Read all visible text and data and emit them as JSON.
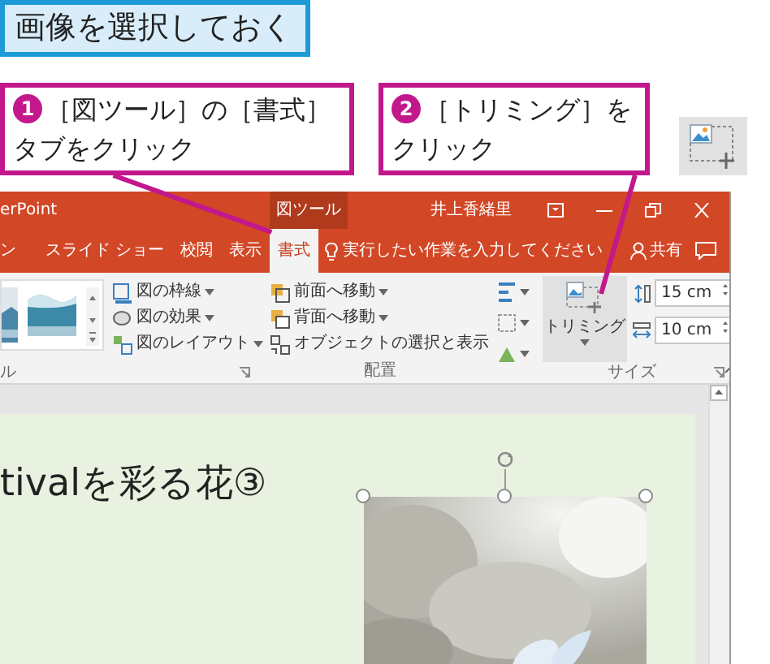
{
  "heading": "画像を選択しておく",
  "callouts": [
    {
      "number": "1",
      "lines": [
        "［図ツール］の［書式］",
        "タブをクリック"
      ]
    },
    {
      "number": "2",
      "lines": [
        "［トリミング］を",
        "クリック"
      ]
    }
  ],
  "window": {
    "title": "erPoint",
    "context_tab": "図ツール",
    "user": "井上香緒里"
  },
  "tabs": [
    {
      "label": "ン",
      "selected": false
    },
    {
      "label": "スライド ショー",
      "selected": false
    },
    {
      "label": "校閲",
      "selected": false
    },
    {
      "label": "表示",
      "selected": false
    },
    {
      "label": "書式",
      "selected": true
    }
  ],
  "tell_me": "実行したい作業を入力してください",
  "share": "共有",
  "ribbon": {
    "left_group_label": "ル",
    "picture_commands": [
      "図の枠線",
      "図の効果",
      "図のレイアウト"
    ],
    "arrange_commands": [
      "前面へ移動",
      "背面へ移動",
      "オブジェクトの選択と表示"
    ],
    "arrange_label": "配置",
    "crop_label": "トリミング",
    "height": "15 cm",
    "width": "10 cm",
    "size_label": "サイズ"
  },
  "slide": {
    "title": "tivalを彩る花③"
  }
}
